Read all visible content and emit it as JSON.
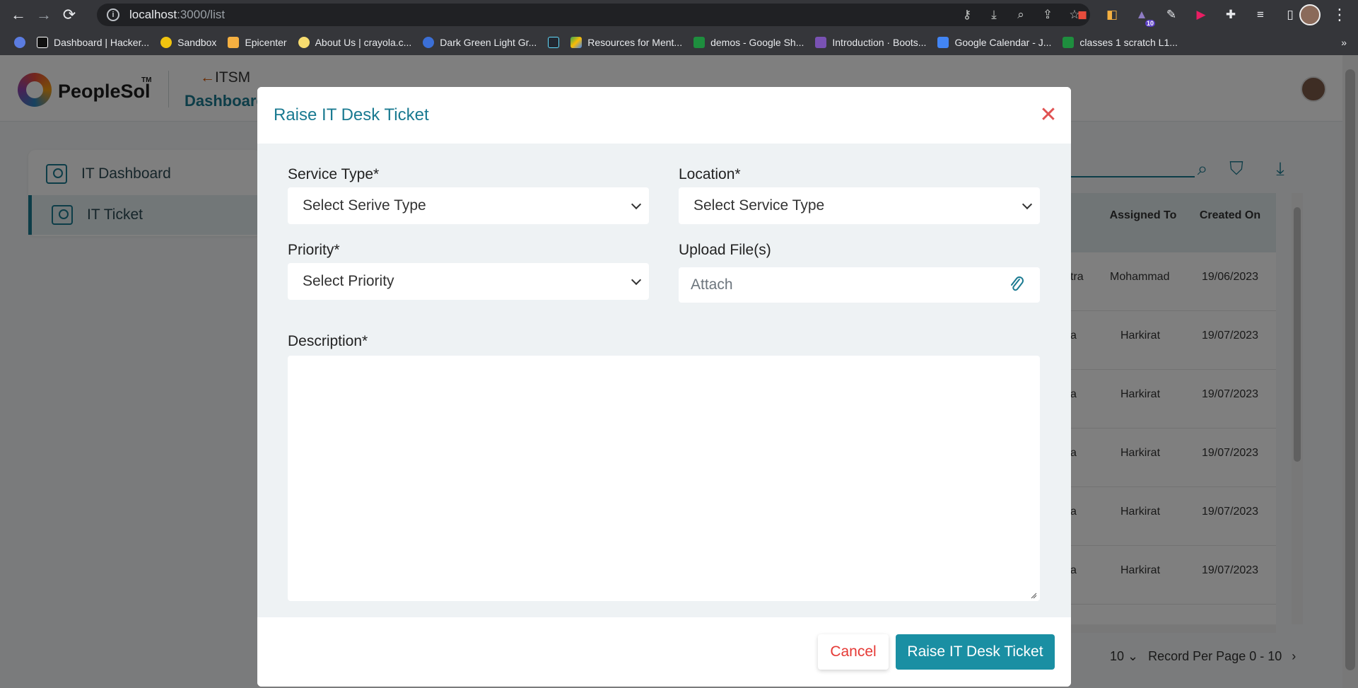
{
  "browser": {
    "url_host": "localhost",
    "url_path": ":3000/list",
    "bookmarks": [
      {
        "label": "Dashboard | Hacker...",
        "color": "#111111"
      },
      {
        "label": "Sandbox",
        "color": "#f1c40f"
      },
      {
        "label": "Epicenter",
        "color": "#f5b041"
      },
      {
        "label": "About Us | crayola.c...",
        "color": "#f7dc6f"
      },
      {
        "label": "Dark Green Light Gr...",
        "color": "#3b6fd6"
      },
      {
        "label": "",
        "color": "#222831"
      },
      {
        "label": "Resources for Ment...",
        "color": "#34a853"
      },
      {
        "label": "demos - Google Sh...",
        "color": "#1e8e3e"
      },
      {
        "label": "Introduction · Boots...",
        "color": "#7952b3"
      },
      {
        "label": "Google Calendar - J...",
        "color": "#4285f4"
      },
      {
        "label": "classes 1 scratch L1...",
        "color": "#1e8e3e"
      }
    ],
    "bookmarks_more": "»",
    "extension_badge": "10"
  },
  "app": {
    "brand": "PeopleSol",
    "brand_tm": "TM",
    "back_label": "ITSM",
    "page_heading": "Dashboard",
    "sidebar": [
      {
        "label": "IT Dashboard"
      },
      {
        "label": "IT Ticket"
      }
    ],
    "table": {
      "headers": [
        "Assigned To",
        "Created On"
      ],
      "partial_col": [
        "tra",
        "a",
        "a",
        "a",
        "a",
        "a"
      ],
      "rows": [
        {
          "assigned": "Mohammad",
          "created": "19/06/2023"
        },
        {
          "assigned": "Harkirat",
          "created": "19/07/2023"
        },
        {
          "assigned": "Harkirat",
          "created": "19/07/2023"
        },
        {
          "assigned": "Harkirat",
          "created": "19/07/2023"
        },
        {
          "assigned": "Harkirat",
          "created": "19/07/2023"
        },
        {
          "assigned": "Harkirat",
          "created": "19/07/2023"
        }
      ]
    },
    "pagination": {
      "per_page": "10",
      "label": "Record Per Page 0 - 10"
    }
  },
  "modal": {
    "title": "Raise IT Desk Ticket",
    "service_type": {
      "label": "Service Type*",
      "value": "Select Serive Type"
    },
    "location": {
      "label": "Location*",
      "value": "Select Service Type"
    },
    "priority": {
      "label": "Priority*",
      "value": "Select Priority"
    },
    "upload": {
      "label": "Upload File(s)",
      "placeholder": "Attach"
    },
    "description": {
      "label": "Description*",
      "value": ""
    },
    "cancel_label": "Cancel",
    "submit_label": "Raise IT Desk Ticket"
  },
  "colors": {
    "accent": "#1a7a91",
    "primary_button": "#1a8fa3",
    "cancel_text": "#e53935",
    "close_icon": "#e05252"
  }
}
